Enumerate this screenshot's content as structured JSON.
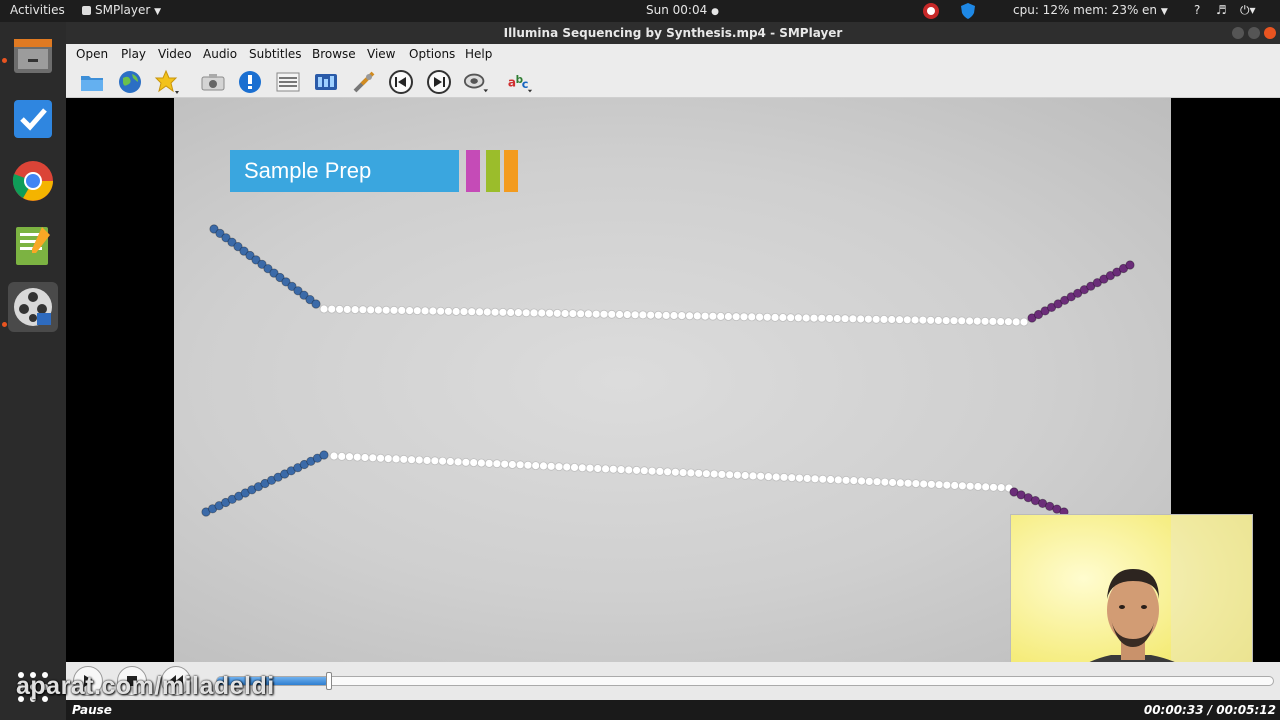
{
  "topbar": {
    "activities": "Activities",
    "app_menu": "SMPlayer",
    "clock": "Sun 00:04",
    "cpu_mem": "cpu: 12% mem: 23%",
    "language": "en"
  },
  "window": {
    "title": "Illumina Sequencing by Synthesis.mp4 - SMPlayer"
  },
  "menubar": {
    "items": [
      "Open",
      "Play",
      "Video",
      "Audio",
      "Subtitles",
      "Browse",
      "View",
      "Options",
      "Help"
    ]
  },
  "toolbar": {
    "icons": [
      "open-file-icon",
      "open-url-icon",
      "favorites-icon",
      "screenshot-icon",
      "info-icon",
      "playlist-icon",
      "video-equalizer-icon",
      "preferences-icon",
      "previous-icon",
      "next-icon",
      "audio-track-icon",
      "subtitles-icon"
    ]
  },
  "video": {
    "banner_text": "Sample Prep",
    "stripe_colors": [
      "#c54bb7",
      "#9bbd2b",
      "#f39b1e"
    ],
    "strand_colors": {
      "left": "#3b6aa8",
      "middle": "#ffffff",
      "right": "#6b2d79"
    }
  },
  "controls": {
    "progress": 0.106
  },
  "status": {
    "state": "Pause",
    "time": "00:00:33 / 00:05:12"
  },
  "watermark": "aparat.com/miladeldi"
}
